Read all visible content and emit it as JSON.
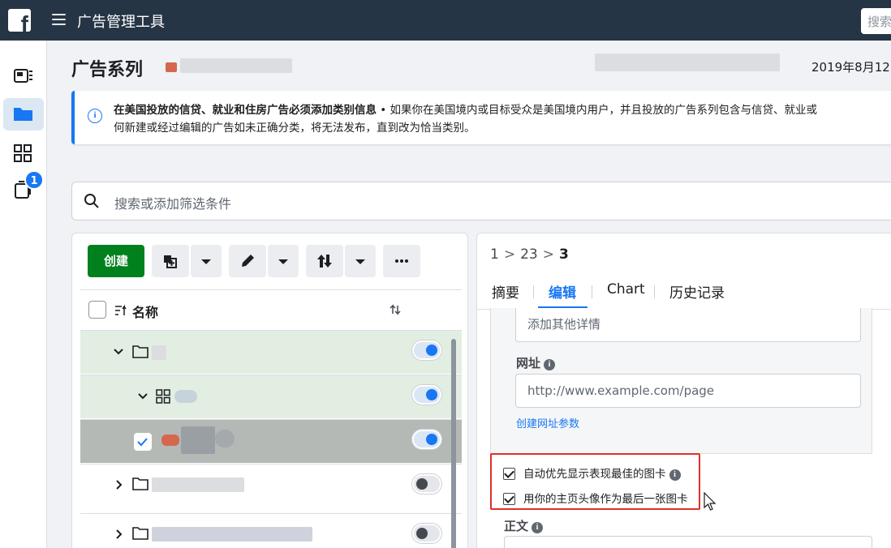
{
  "topbar": {
    "logo": "f",
    "title": "广告管理工具",
    "search_placeholder": "搜索"
  },
  "rail": {
    "badge": "1"
  },
  "header": {
    "title": "广告系列",
    "date": "2019年8月12"
  },
  "notice": {
    "bold": "在美国投放的信贷、就业和住房广告必须添加类别信息",
    "rest": " • 如果你在美国境内或目标受众是美国境内用户，并且投放的广告系列包含与信贷、就业或",
    "line2": "何新建或经过编辑的广告如未正确分类，将无法发布，直到改为恰当类别。"
  },
  "filter": {
    "placeholder": "搜索或添加筛选条件"
  },
  "left_panel": {
    "create_label": "创建",
    "column_name": "名称"
  },
  "right_panel": {
    "breadcrumb": [
      "1",
      "23",
      "3"
    ],
    "tabs": [
      "摘要",
      "编辑",
      "Chart",
      "历史记录"
    ],
    "details_placeholder": "添加其他详情",
    "url_label": "网址",
    "url_placeholder": "http://www.example.com/page",
    "url_params_link": "创建网址参数",
    "option1": "自动优先显示表现最佳的图卡",
    "option2": "用你的主页头像作为最后一张图卡",
    "body_label": "正文"
  }
}
